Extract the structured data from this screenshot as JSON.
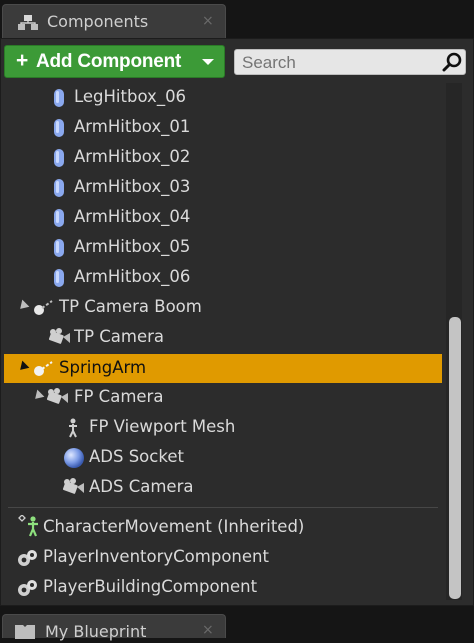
{
  "tabs": {
    "components": {
      "label": "Components",
      "close": "×"
    },
    "my_blueprint": {
      "label": "My Blueprint",
      "close": "×"
    }
  },
  "toolbar": {
    "add_component": {
      "plus": "+",
      "label": "Add Component"
    },
    "search_placeholder": "Search"
  },
  "tree": {
    "items": [
      {
        "label": "LegHitbox_06",
        "icon": "capsule-icon"
      },
      {
        "label": "ArmHitbox_01",
        "icon": "capsule-icon"
      },
      {
        "label": "ArmHitbox_02",
        "icon": "capsule-icon"
      },
      {
        "label": "ArmHitbox_03",
        "icon": "capsule-icon"
      },
      {
        "label": "ArmHitbox_04",
        "icon": "capsule-icon"
      },
      {
        "label": "ArmHitbox_05",
        "icon": "capsule-icon"
      },
      {
        "label": "ArmHitbox_06",
        "icon": "capsule-icon"
      },
      {
        "label": "TP Camera Boom",
        "icon": "spring-arm-icon",
        "expanded": true
      },
      {
        "label": "TP Camera",
        "icon": "camera-icon"
      },
      {
        "label": "SpringArm",
        "icon": "spring-arm-icon",
        "expanded": true,
        "selected": true
      },
      {
        "label": "FP Camera",
        "icon": "camera-icon",
        "expanded": true
      },
      {
        "label": "FP Viewport Mesh",
        "icon": "skeletal-mesh-icon"
      },
      {
        "label": "ADS Socket",
        "icon": "sphere-icon"
      },
      {
        "label": "ADS Camera",
        "icon": "camera-icon"
      }
    ],
    "inherited": [
      {
        "label": "CharacterMovement (Inherited)",
        "icon": "character-movement-icon"
      },
      {
        "label": "PlayerInventoryComponent",
        "icon": "actor-component-icon"
      },
      {
        "label": "PlayerBuildingComponent",
        "icon": "actor-component-icon"
      }
    ]
  },
  "colors": {
    "selected": "#e09a00",
    "add_button": "#3c9a37",
    "panel_bg": "#2c2c2c"
  }
}
